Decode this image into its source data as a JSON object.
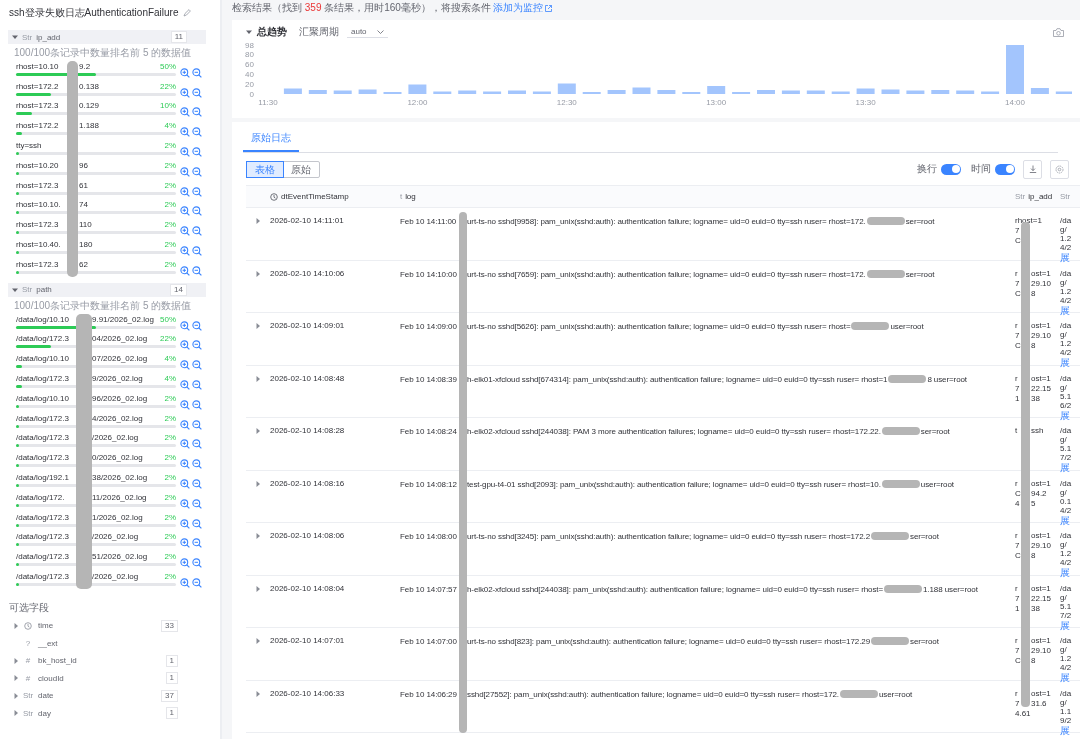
{
  "title": "ssh登录失败日志AuthenticationFailure",
  "sections": [
    {
      "glyph": "Str",
      "name": "ip_add",
      "count": "11",
      "expanded": true,
      "caption": "100/100条记录中数量排名前 5 的数据值",
      "items": [
        {
          "pre": "rhost=10.10",
          "post": "9.2",
          "pct": "50%",
          "level": 0.5
        },
        {
          "pre": "rhost=172.2",
          "post": "0.138",
          "pct": "22%",
          "level": 0.22
        },
        {
          "pre": "rhost=172.3",
          "post": "0.129",
          "pct": "10%",
          "level": 0.1
        },
        {
          "pre": "rhost=172.2",
          "post": "1.188",
          "pct": "4%",
          "level": 0.04
        },
        {
          "pre": "tty=ssh",
          "pct": "2%",
          "level": 0.02
        },
        {
          "pre": "rhost=10.20",
          "post": "96",
          "pct": "2%",
          "level": 0.02
        },
        {
          "pre": "rhost=172.3",
          "post": "61",
          "pct": "2%",
          "level": 0.02
        },
        {
          "pre": "rhost=10.10.",
          "post": "74",
          "pct": "2%",
          "level": 0.02
        },
        {
          "pre": "rhost=172.3",
          "post": "110",
          "pct": "2%",
          "level": 0.02
        },
        {
          "pre": "rhost=10.40.",
          "post": "180",
          "pct": "2%",
          "level": 0.02
        },
        {
          "pre": "rhost=172.3",
          "post": "62",
          "pct": "2%",
          "level": 0.02
        }
      ]
    },
    {
      "glyph": "Str",
      "name": "path",
      "count": "14",
      "expanded": true,
      "caption": "100/100条记录中数量排名前 5 的数据值",
      "items": [
        {
          "pre": "/data/log/10.10",
          "post": "9.91/2026_02.log",
          "pct": "50%",
          "level": 0.5
        },
        {
          "pre": "/data/log/172.3",
          "post": "04/2026_02.log",
          "pct": "22%",
          "level": 0.22
        },
        {
          "pre": "/data/log/10.10",
          "post": "07/2026_02.log",
          "pct": "4%",
          "level": 0.04
        },
        {
          "pre": "/data/log/172.3",
          "post": "9/2026_02.log",
          "pct": "4%",
          "level": 0.04
        },
        {
          "pre": "/data/log/10.10",
          "post": "96/2026_02.log",
          "pct": "2%",
          "level": 0.02
        },
        {
          "pre": "/data/log/172.3",
          "post": "4/2026_02.log",
          "pct": "2%",
          "level": 0.02
        },
        {
          "pre": "/data/log/172.3",
          "post": "/2026_02.log",
          "pct": "2%",
          "level": 0.02
        },
        {
          "pre": "/data/log/172.3",
          "post": "0/2026_02.log",
          "pct": "2%",
          "level": 0.02
        },
        {
          "pre": "/data/log/192.1",
          "post": "38/2026_02.log",
          "pct": "2%",
          "level": 0.02
        },
        {
          "pre": "/data/log/172.",
          "post": "11/2026_02.log",
          "pct": "2%",
          "level": 0.02
        },
        {
          "pre": "/data/log/172.3",
          "post": "1/2026_02.log",
          "pct": "2%",
          "level": 0.02
        },
        {
          "pre": "/data/log/172.3",
          "post": "/2026_02.log",
          "pct": "2%",
          "level": 0.02
        },
        {
          "pre": "/data/log/172.3",
          "post": "51/2026_02.log",
          "pct": "2%",
          "level": 0.02
        },
        {
          "pre": "/data/log/172.3",
          "post": "/2026_02.log",
          "pct": "2%",
          "level": 0.02
        }
      ]
    }
  ],
  "optional_fields": {
    "heading": "可选字段",
    "fields": [
      {
        "kind": "clock",
        "name": "time",
        "count": "33",
        "expandable": true
      },
      {
        "kind": "glyph",
        "glyph": "?",
        "name": "__ext",
        "expandable": false
      },
      {
        "kind": "glyph",
        "glyph": "#",
        "name": "bk_host_id",
        "count": "1",
        "expandable": true
      },
      {
        "kind": "glyph",
        "glyph": "#",
        "name": "cloudId",
        "count": "1",
        "expandable": true
      },
      {
        "kind": "glyph",
        "glyph": "Str",
        "name": "date",
        "count": "37",
        "expandable": true
      },
      {
        "kind": "glyph",
        "glyph": "Str",
        "name": "day",
        "count": "1",
        "expandable": true
      }
    ]
  },
  "result": {
    "prefix": "检索结果（找到 ",
    "count": "359",
    "suffix": " 条结果，用时160毫秒），将搜索条件 ",
    "link": "添加为监控"
  },
  "trend": {
    "expanded": true,
    "period_label": "汇聚周期",
    "period": "auto",
    "chart_data": {
      "type": "bar",
      "title": "总趋势",
      "categories": [
        "11:30",
        null,
        null,
        null,
        null,
        null,
        "12:00",
        null,
        null,
        null,
        null,
        null,
        "12:30",
        null,
        null,
        null,
        null,
        null,
        "13:00",
        null,
        null,
        null,
        null,
        null,
        "13:30",
        null,
        null,
        null,
        null,
        null,
        "14:00",
        null,
        null
      ],
      "values": [
        null,
        11,
        8,
        7,
        9,
        4,
        19,
        5,
        7,
        5,
        7,
        5,
        21,
        4,
        8,
        13,
        8,
        4,
        16,
        4,
        8,
        7,
        7,
        5,
        11,
        9,
        7,
        8,
        7,
        5,
        98,
        12,
        5
      ],
      "yticks": [
        0,
        20,
        40,
        60,
        80,
        98
      ],
      "ylim": [
        0,
        98
      ]
    }
  },
  "tabs": [
    {
      "label": "原始日志",
      "selected": true
    }
  ],
  "view_modes": [
    {
      "label": "表格",
      "selected": true
    },
    {
      "label": "原始",
      "selected": false
    }
  ],
  "toggles": [
    {
      "label": "换行",
      "on": true
    },
    {
      "label": "时间",
      "on": true
    }
  ],
  "table": {
    "columns": [
      {
        "kind": "clock",
        "name": "dtEventTimeStamp"
      },
      {
        "kind": "glyph",
        "glyph": "t",
        "name": "log"
      },
      {
        "kind": "glyph",
        "glyph": "Str",
        "name": "ip_add"
      },
      {
        "kind": "glyph",
        "glyph": "Str"
      }
    ],
    "rows": [
      {
        "time": "2026-02-10 14:11:01",
        "log_time": "Feb 10 14:11:00",
        "log": "urt-ts-no sshd[9958]: pam_unix(sshd:auth): authentication failure; logname= uid=0 euid=0 tty=ssh ruser= rhost=172.",
        "log_tail": "ser=root",
        "ip": [
          {
            "a": "rhost=1"
          },
          {
            "a": "7"
          },
          {
            "a": "C"
          }
        ],
        "path": [
          "/da",
          "g/",
          "1.2",
          "4/2"
        ],
        "more": "展"
      },
      {
        "time": "2026-02-10 14:10:06",
        "log_time": "Feb 10 14:10:00",
        "log": "urt-ts-no sshd[7659]: pam_unix(sshd:auth): authentication failure; logname= uid=0 euid=0 tty=ssh ruser= rhost=172.",
        "log_tail": "ser=root",
        "ip": [
          {
            "a": "r",
            "b": "ost=1"
          },
          {
            "a": "7",
            "b": "29.10"
          },
          {
            "a": "C",
            "b": "8"
          }
        ],
        "path": [
          "/da",
          "g/",
          "1.2",
          "4/2"
        ],
        "more": "展"
      },
      {
        "time": "2026-02-10 14:09:01",
        "log_time": "Feb 10 14:09:00",
        "log": "urt-ts-no sshd[5626]: pam_unix(sshd:auth): authentication failure; logname= uid=0 euid=0 tty=ssh ruser= rhost=",
        "log_tail": "user=root",
        "ip": [
          {
            "a": "r",
            "b": "ost=1"
          },
          {
            "a": "7",
            "b": "29.10"
          },
          {
            "a": "C",
            "b": "8"
          }
        ],
        "path": [
          "/da",
          "g/",
          "1.2",
          "4/2"
        ],
        "more": "展"
      },
      {
        "time": "2026-02-10 14:08:48",
        "log_time": "Feb 10 14:08:39",
        "log": "h-elk01-xfcloud sshd[674314]: pam_unix(sshd:auth): authentication failure; logname= uid=0 euid=0 tty=ssh ruser= rhost=1",
        "log_tail": "8 user=root",
        "ip": [
          {
            "a": "r",
            "b": "ost=1"
          },
          {
            "a": "7",
            "b": "22.15"
          },
          {
            "a": "1",
            "b": "38"
          }
        ],
        "path": [
          "/da",
          "g/",
          "5.1",
          "6/2"
        ],
        "more": "展"
      },
      {
        "time": "2026-02-10 14:08:28",
        "log_time": "Feb 10 14:08:24",
        "log": "h-elk02-xfcloud sshd[244038]: PAM 3 more authentication failures; logname= uid=0 euid=0 tty=ssh ruser= rhost=172.22.",
        "log_tail": "ser=root",
        "ip": [
          {
            "a": "t",
            "b": "ssh"
          }
        ],
        "path": [
          "/da",
          "g/",
          "5.1",
          "7/2"
        ],
        "more": "展"
      },
      {
        "time": "2026-02-10 14:08:16",
        "log_time": "Feb 10 14:08:12",
        "log": "test-gpu-t4-01 sshd[2093]: pam_unix(sshd:auth): authentication failure; logname= uid=0 euid=0 tty=ssh ruser= rhost=10.",
        "log_tail": "user=root",
        "ip": [
          {
            "a": "r",
            "b": "ost=1"
          },
          {
            "a": "C",
            "b": "94.2"
          },
          {
            "a": "4",
            "b": "5"
          }
        ],
        "path": [
          "/da",
          "g/",
          "0.1",
          "4/2"
        ],
        "more": "展"
      },
      {
        "time": "2026-02-10 14:08:06",
        "log_time": "Feb 10 14:08:00",
        "log": "urt-ts-no sshd[3245]: pam_unix(sshd:auth): authentication failure; logname= uid=0 euid=0 tty=ssh ruser= rhost=172.2",
        "log_tail": "ser=root",
        "ip": [
          {
            "a": "r",
            "b": "ost=1"
          },
          {
            "a": "7",
            "b": "29.10"
          },
          {
            "a": "C",
            "b": "8"
          }
        ],
        "path": [
          "/da",
          "g/",
          "1.2",
          "4/2"
        ],
        "more": "展"
      },
      {
        "time": "2026-02-10 14:08:04",
        "log_time": "Feb 10 14:07:57",
        "log": "h-elk02-xfcloud sshd[244038]: pam_unix(sshd:auth): authentication failure; logname= uid=0 euid=0 tty=ssh ruser= rhost=",
        "log_tail": "1.188 user=root",
        "ip": [
          {
            "a": "r",
            "b": "ost=1"
          },
          {
            "a": "7",
            "b": "22.15"
          },
          {
            "a": "1",
            "b": "38"
          }
        ],
        "path": [
          "/da",
          "g/",
          "5.1",
          "7/2"
        ],
        "more": "展"
      },
      {
        "time": "2026-02-10 14:07:01",
        "log_time": "Feb 10 14:07:00",
        "log": "urt-ts-no sshd[823]: pam_unix(sshd:auth): authentication failure; logname= uid=0 euid=0 tty=ssh ruser= rhost=172.29",
        "log_tail": "ser=root",
        "ip": [
          {
            "a": "r",
            "b": "ost=1"
          },
          {
            "a": "7",
            "b": "29.10"
          },
          {
            "a": "C",
            "b": "8"
          }
        ],
        "path": [
          "/da",
          "g/",
          "1.2",
          "4/2"
        ],
        "more": "展"
      },
      {
        "time": "2026-02-10 14:06:33",
        "log_time": "Feb 10 14:06:29",
        "log": "sshd[27552]: pam_unix(sshd:auth): authentication failure; logname= uid=0 euid=0 tty=ssh ruser= rhost=172.",
        "log_tail": "user=root",
        "ip": [
          {
            "a": "r",
            "b": "ost=1"
          },
          {
            "a": "7",
            "b": "31.6"
          },
          {
            "a": "4.61"
          }
        ],
        "path": [
          "/da",
          "g/",
          "1.1",
          "9/2"
        ],
        "more": "展"
      }
    ]
  }
}
